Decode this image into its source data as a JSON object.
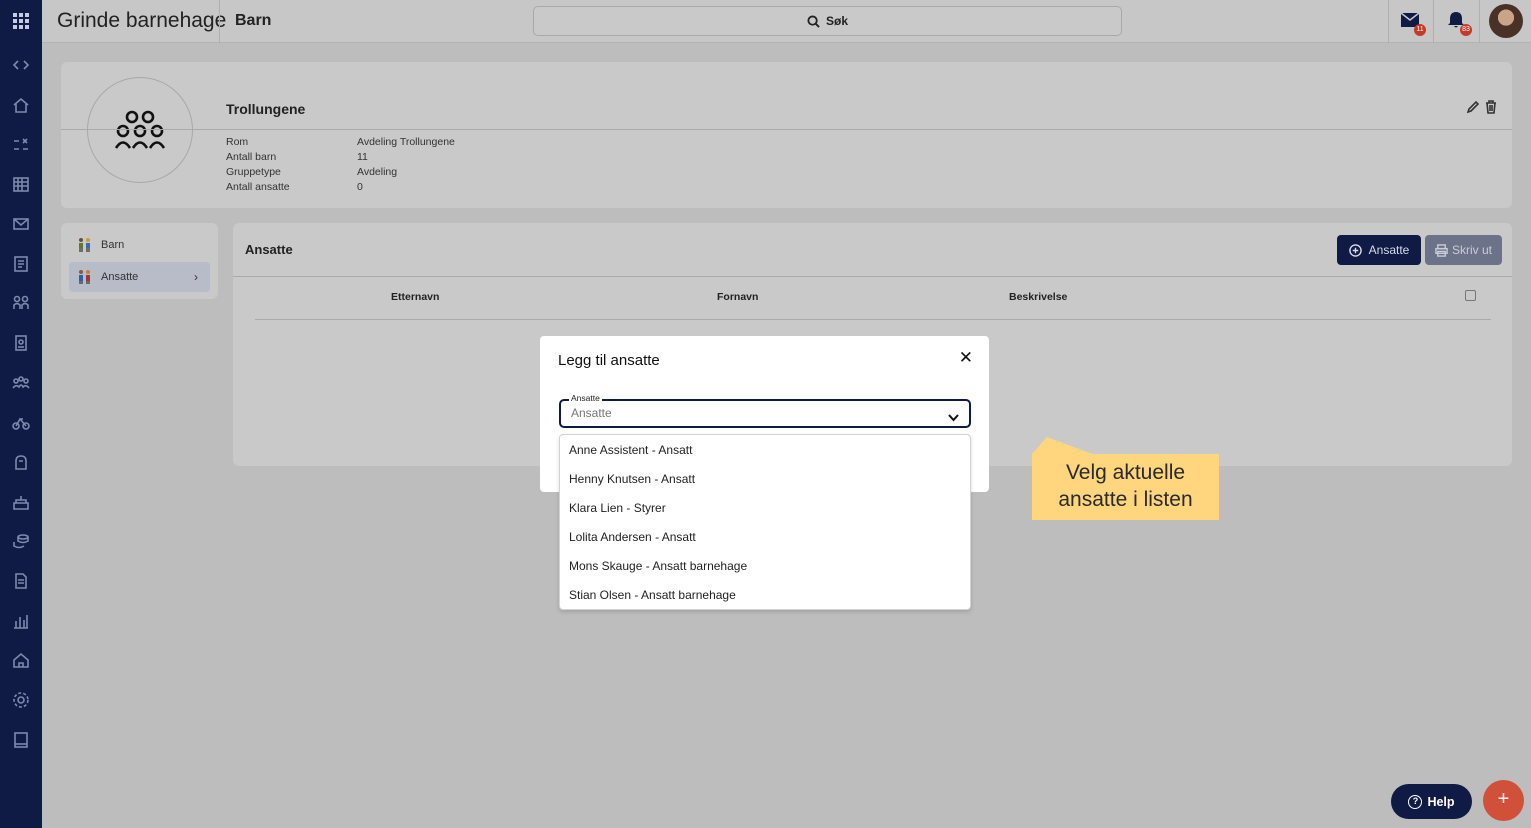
{
  "app": {
    "title": "Grinde barnehage",
    "breadcrumb": "Barn",
    "search_label": "Søk",
    "messages_badge": "11",
    "notifications_badge": "83"
  },
  "group": {
    "name": "Trollungene",
    "fields": [
      {
        "label": "Rom",
        "value": "Avdeling Trollungene"
      },
      {
        "label": "Antall barn",
        "value": "11"
      },
      {
        "label": "Gruppetype",
        "value": "Avdeling"
      },
      {
        "label": "Antall ansatte",
        "value": "0"
      }
    ]
  },
  "side_nav": [
    {
      "label": "Barn"
    },
    {
      "label": "Ansatte",
      "chevron": "›"
    }
  ],
  "employees": {
    "title": "Ansatte",
    "add_button": "Ansatte",
    "print_button": "Skriv ut",
    "columns": [
      "Etternavn",
      "Fornavn",
      "Beskrivelse"
    ]
  },
  "modal": {
    "title": "Legg til ansatte",
    "close": "✕",
    "select_legend": "Ansatte",
    "select_placeholder": "Ansatte",
    "options": [
      "Anne Assistent - Ansatt",
      "Henny Knutsen - Ansatt",
      "Klara Lien - Styrer",
      "Lolita Andersen - Ansatt",
      "Mons Skauge - Ansatt barnehage",
      "Stian Olsen - Ansatt barnehage"
    ]
  },
  "callout": {
    "line1": "Velg aktuelle",
    "line2": "ansatte i listen"
  },
  "help_button": "Help",
  "fab": "+",
  "colors": {
    "navy": "#101b45",
    "callout": "#ffd57e",
    "fab": "#d0503a",
    "badge": "#c63b27"
  }
}
